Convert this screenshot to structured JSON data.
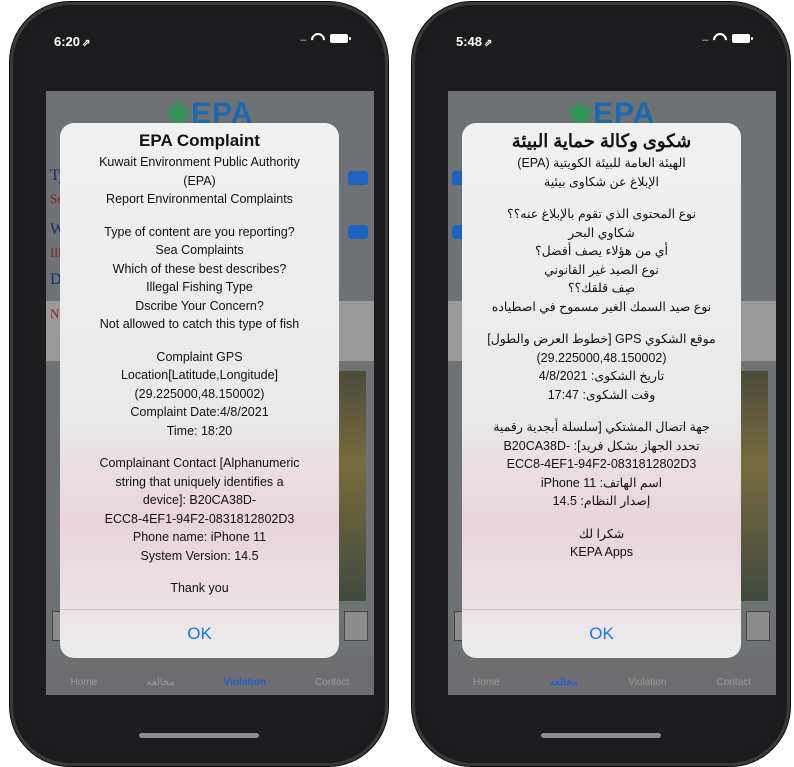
{
  "left": {
    "status": {
      "time": "6:20",
      "loc": "⇗"
    },
    "logo": "EPA",
    "bg": {
      "rows": [
        "Typ",
        "Sea",
        "Wh",
        "Ille",
        "Dsc",
        "No"
      ]
    },
    "alert": {
      "title": "EPA Complaint",
      "lines": [
        "Kuwait Environment Public Authority",
        "(EPA)",
        "Report Environmental Complaints",
        "",
        "Type of content are you reporting?",
        "Sea Complaints",
        "Which of these best describes?",
        "Illegal Fishing Type",
        "Dscribe Your Concern?",
        "Not allowed to catch this type of fish",
        "",
        "Complaint GPS",
        "Location[Latitude,Longitude]",
        "(29.225000,48.150002)",
        "Complaint Date:4/8/2021",
        "Time: 18:20",
        "",
        "Complainant Contact [Alphanumeric",
        "string that uniquely identifies a",
        "device]: B20CA38D-",
        "ECC8-4EF1-94F2-0831812802D3",
        "Phone name: iPhone 11",
        "System Version: 14.5",
        "",
        "Thank you"
      ],
      "ok": "OK"
    },
    "tabs": [
      "Home",
      "مخالفه",
      "Violation",
      "Contact"
    ],
    "active_tab": 2
  },
  "right": {
    "status": {
      "time": "5:48",
      "loc": "⇗"
    },
    "logo": "EPA",
    "alert": {
      "title": "شكوى وكالة حماية البيئة",
      "lines": [
        "الهيئة العامة للبيئة الكويتية (EPA)",
        "الإبلاغ عن شكاوى بيئية",
        "",
        "نوع المحتوى الذي تقوم بالإبلاغ عنه؟؟",
        "شكاوي البحر",
        "أي من هؤلاء يصف أفضل؟",
        "نوع الصيد غير القانوني",
        "صِف قلقك؟؟",
        "نوع صيد السمك الغير مسموح في اصطياده",
        "",
        "موقع الشكوي GPS [خطوط العرض والطول]",
        "(29.225000,48.150002)",
        "تاريخ الشكوى: 4/8/2021",
        "وقت الشكوى: 17:47",
        "",
        "جهة اتصال المشتكي [سلسلة أبجدية رقمية",
        "تحدد الجهاز بشكل فريد]: -B20CA38D",
        "ECC8-4EF1-94F2-0831812802D3",
        "اسم الهاتف: iPhone 11",
        "إصدار النظام: 14.5",
        "",
        "شكرا لك",
        "KEPA Apps"
      ],
      "ok": "OK"
    },
    "tabs": [
      "Home",
      "مخالفه",
      "Violation",
      "Contact"
    ],
    "active_tab": 1
  }
}
